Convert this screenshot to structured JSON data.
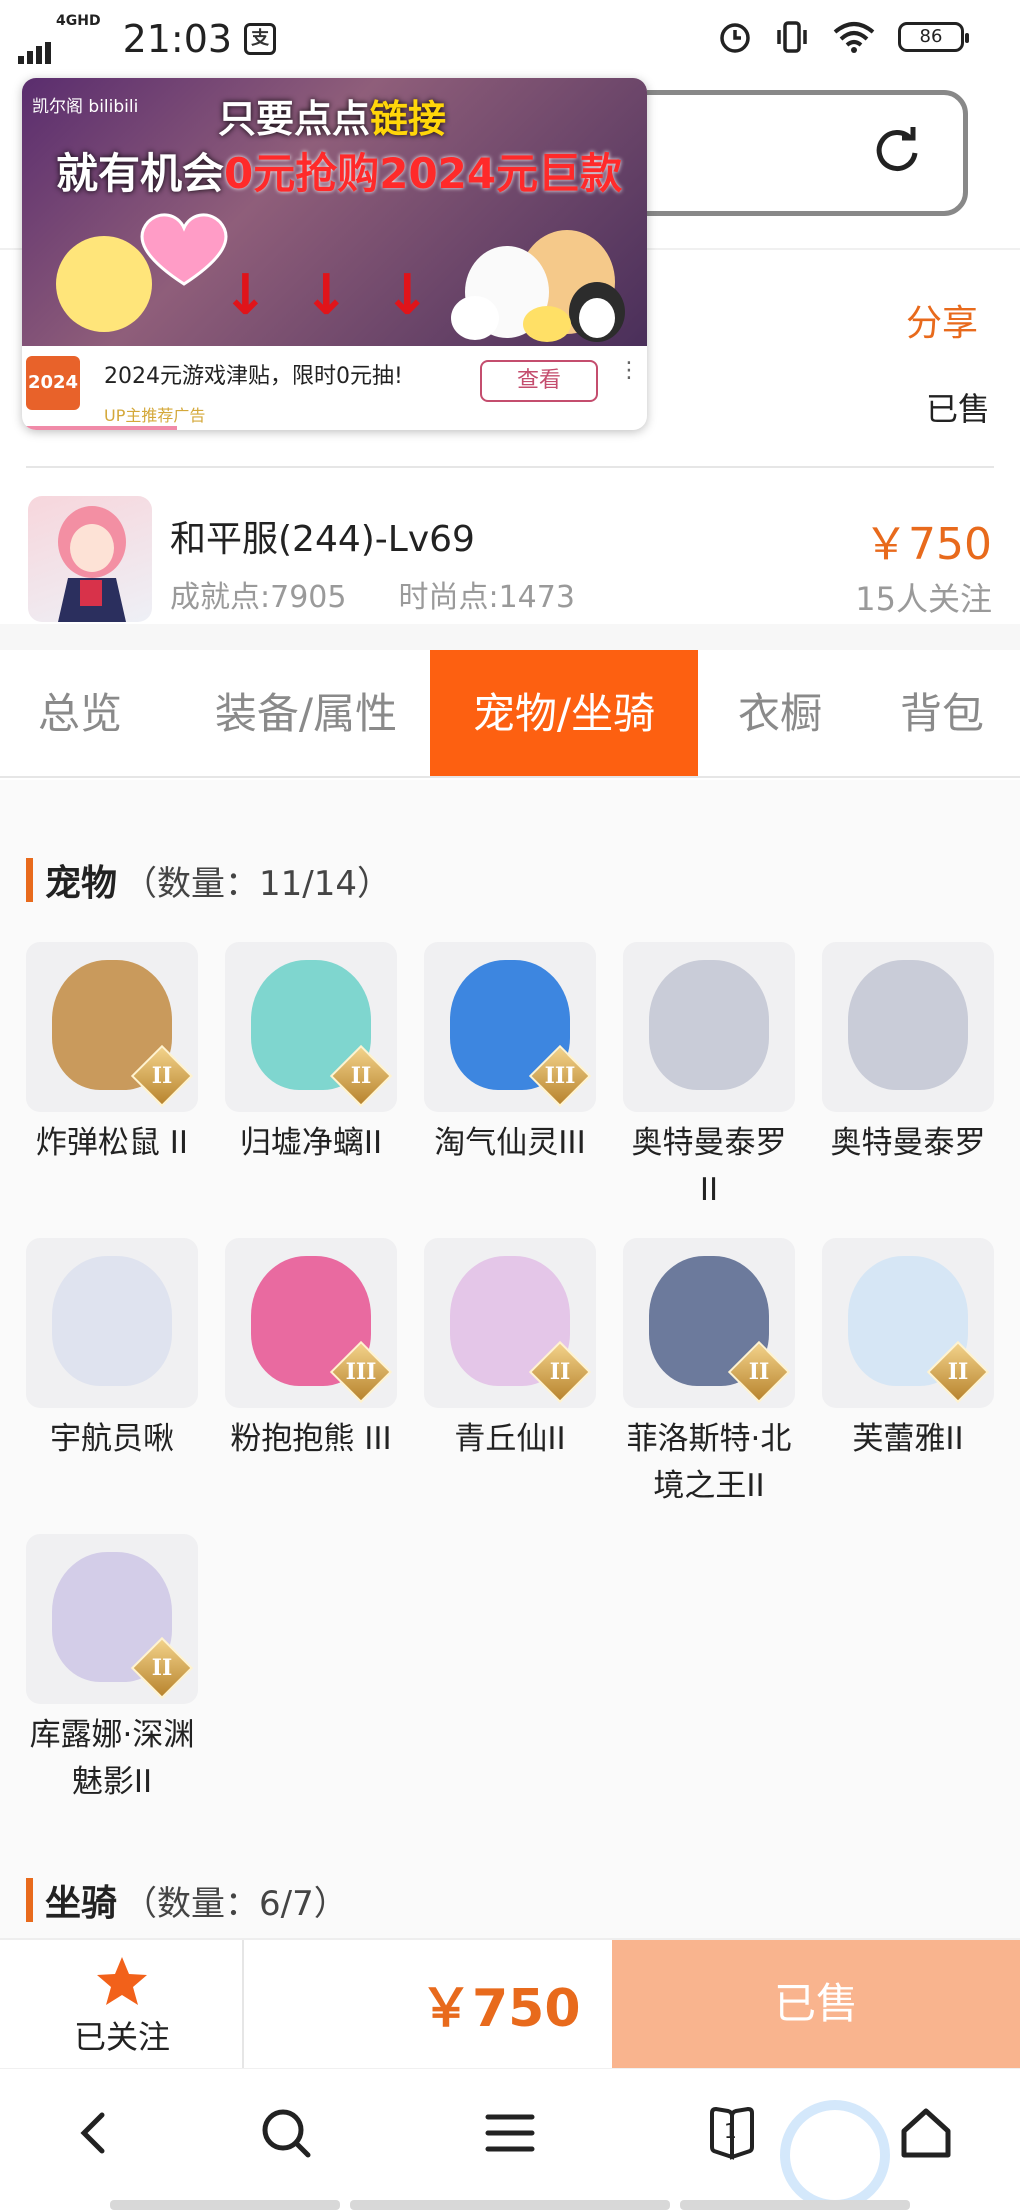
{
  "status_bar": {
    "network": "4GHD",
    "time": "21:03",
    "app_mark": "支",
    "battery": "86"
  },
  "header": {
    "share_label": "分享",
    "sold_label": "已售"
  },
  "ad": {
    "logo_text": "凯尔阁 bilibili",
    "headline_line1_prefix": "只要点点",
    "headline_line1_highlight": "链接",
    "headline_line2_prefix": "就有机会",
    "headline_line2_highlight": "0元抢购2024元巨款",
    "icon_text": "2024",
    "body_text": "2024元游戏津贴，限时0元抽!",
    "button_label": "查看",
    "more_label": "⋮",
    "tag": "UP主推荐广告"
  },
  "product": {
    "name": "和平服(244)-Lv69",
    "achievement": "成就点:7905",
    "fashion": "时尚点:1473",
    "price": "￥750",
    "followers": "15人关注"
  },
  "tabs": [
    {
      "label": "总览",
      "active": false
    },
    {
      "label": "装备/属性",
      "active": false
    },
    {
      "label": "宠物/坐骑",
      "active": true
    },
    {
      "label": "衣橱",
      "active": false
    },
    {
      "label": "背包",
      "active": false
    }
  ],
  "pets_section": {
    "title": "宠物",
    "count": "（数量：11/14）",
    "items": [
      {
        "label": "炸弹松鼠 II",
        "badge": "II",
        "color": "#c99a5c"
      },
      {
        "label": "归墟净螭II",
        "badge": "II",
        "color": "#7fd6cf"
      },
      {
        "label": "淘气仙灵III",
        "badge": "III",
        "color": "#3d86e0"
      },
      {
        "label": "奥特曼泰罗II",
        "badge": "",
        "color": "#c9ccd8"
      },
      {
        "label": "奥特曼泰罗",
        "badge": "",
        "color": "#c9ccd8"
      },
      {
        "label": "宇航员啾",
        "badge": "",
        "color": "#dfe3ef"
      },
      {
        "label": "粉抱抱熊 III",
        "badge": "III",
        "color": "#e96aa0"
      },
      {
        "label": "青丘仙II",
        "badge": "II",
        "color": "#e4c6e8"
      },
      {
        "label": "菲洛斯特·北境之王II",
        "badge": "II",
        "color": "#6c7a9c"
      },
      {
        "label": "芙蕾雅II",
        "badge": "II",
        "color": "#d6e6f5"
      },
      {
        "label": "库露娜·深渊魅影II",
        "badge": "II",
        "color": "#d3cde8"
      }
    ]
  },
  "mounts_section": {
    "title": "坐骑",
    "count": "（数量：6/7）"
  },
  "action_bar": {
    "follow_label": "已关注",
    "price": "￥750",
    "sold_label": "已售"
  },
  "nav": {
    "tab_count": "1"
  },
  "colors": {
    "accent": "#e86a1c",
    "active_tab": "#fd6011",
    "sold_button": "#f9b48e"
  }
}
